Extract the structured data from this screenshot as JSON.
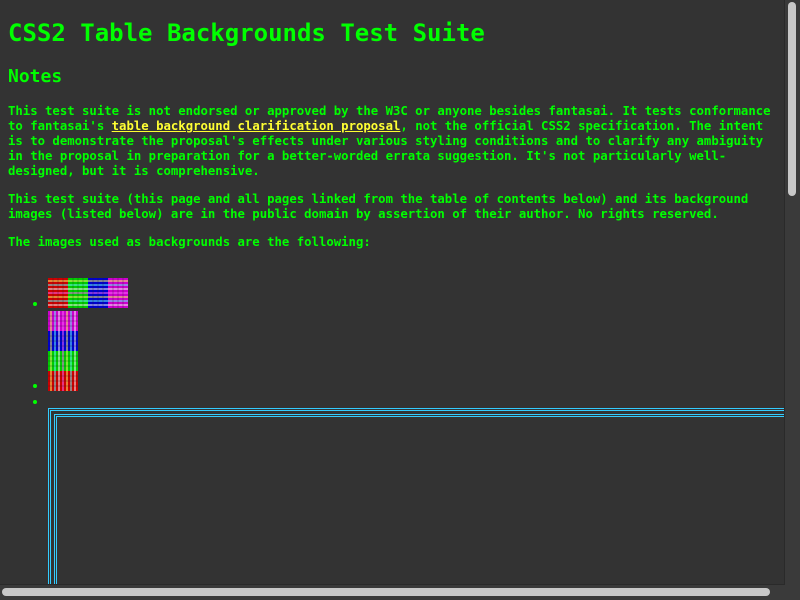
{
  "page": {
    "title": "CSS2 Table Backgrounds Test Suite",
    "notes_heading": "Notes",
    "para1_part1": "This test suite is not endorsed or approved by the W3C or anyone besides fantasai. It tests conformance to fantasai's ",
    "para1_link": "table background clarification proposal",
    "para1_part2": ", not the official CSS2 specification. The intent is to demonstrate the proposal's effects under various styling conditions and to clarify any ambiguity in the proposal in preparation for a better-worded errata suggestion. It's not particularly well-designed, but it is comprehensive.",
    "para2": "This test suite (this page and all pages linked from the table of contents below) and its background images (listed below) are in the public domain by assertion of their author. No rights reserved.",
    "para3": "The images used as backgrounds are the following:"
  },
  "images": [
    {
      "name": "horizontal-stripes-background-image",
      "colors": [
        "#ff0000",
        "#00ff00",
        "#0000ff",
        "#ff00ff"
      ]
    },
    {
      "name": "vertical-stripes-background-image",
      "colors": [
        "#ff00ff",
        "#0000ff",
        "#00ff00",
        "#ff0000"
      ]
    }
  ],
  "colors": {
    "background": "#333333",
    "text": "#00ff00",
    "link": "#ffff33",
    "table_border": "#33ccff"
  }
}
